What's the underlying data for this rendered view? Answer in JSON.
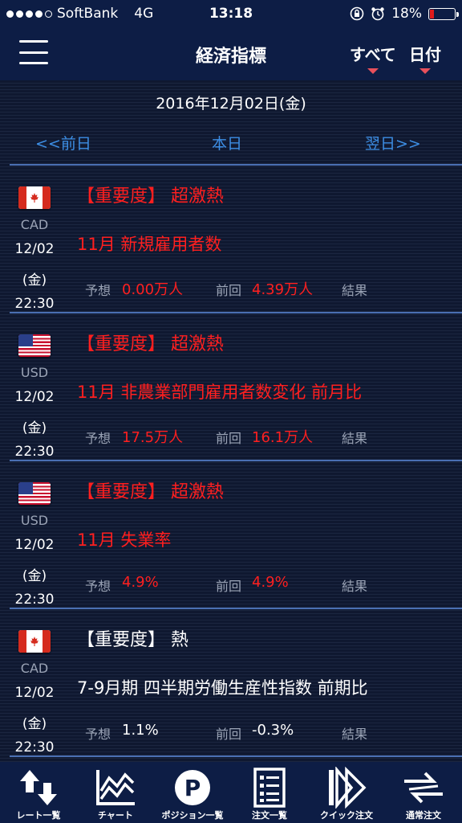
{
  "status_bar": {
    "carrier": "SoftBank",
    "network": "4G",
    "time": "13:18",
    "battery": "18%",
    "battery_color": "#e01b1b"
  },
  "nav": {
    "title": "経済指標",
    "filter_all": "すべて",
    "filter_date": "日付"
  },
  "date_nav": {
    "current_date": "2016年12月02日(金)",
    "prev": "<<前日",
    "today": "本日",
    "next": "翌日>>"
  },
  "labels": {
    "forecast": "予想",
    "previous": "前回",
    "result": "結果"
  },
  "events": [
    {
      "flag": "canada-flag-icon",
      "currency": "CAD",
      "date": "12/02",
      "day": "(金)",
      "time": "22:30",
      "importance": "【重要度】 超激熱",
      "importance_color": "#ff1f1f",
      "title": "11月 新規雇用者数",
      "forecast": "0.00万人",
      "previous": "4.39万人"
    },
    {
      "flag": "us-flag-icon",
      "currency": "USD",
      "date": "12/02",
      "day": "(金)",
      "time": "22:30",
      "importance": "【重要度】 超激熱",
      "importance_color": "#ff1f1f",
      "title": "11月 非農業部門雇用者数変化 前月比",
      "forecast": "17.5万人",
      "previous": "16.1万人"
    },
    {
      "flag": "us-flag-icon",
      "currency": "USD",
      "date": "12/02",
      "day": "(金)",
      "time": "22:30",
      "importance": "【重要度】 超激熱",
      "importance_color": "#ff1f1f",
      "title": "11月 失業率",
      "forecast": "4.9%",
      "previous": "4.9%"
    },
    {
      "flag": "canada-flag-icon",
      "currency": "CAD",
      "date": "12/02",
      "day": "(金)",
      "time": "22:30",
      "importance": "【重要度】 熱",
      "importance_color": "#ffffff",
      "title": "7-9月期 四半期労働生産性指数 前期比",
      "forecast": "1.1%",
      "previous": "-0.3%"
    }
  ],
  "tab_bar": [
    {
      "label": "レート一覧",
      "icon": "rate-list-icon"
    },
    {
      "label": "チャート",
      "icon": "chart-icon"
    },
    {
      "label": "ポジション一覧",
      "icon": "position-icon"
    },
    {
      "label": "注文一覧",
      "icon": "order-list-icon"
    },
    {
      "label": "クイック注文",
      "icon": "quick-order-icon"
    },
    {
      "label": "通常注文",
      "icon": "normal-order-icon"
    }
  ]
}
